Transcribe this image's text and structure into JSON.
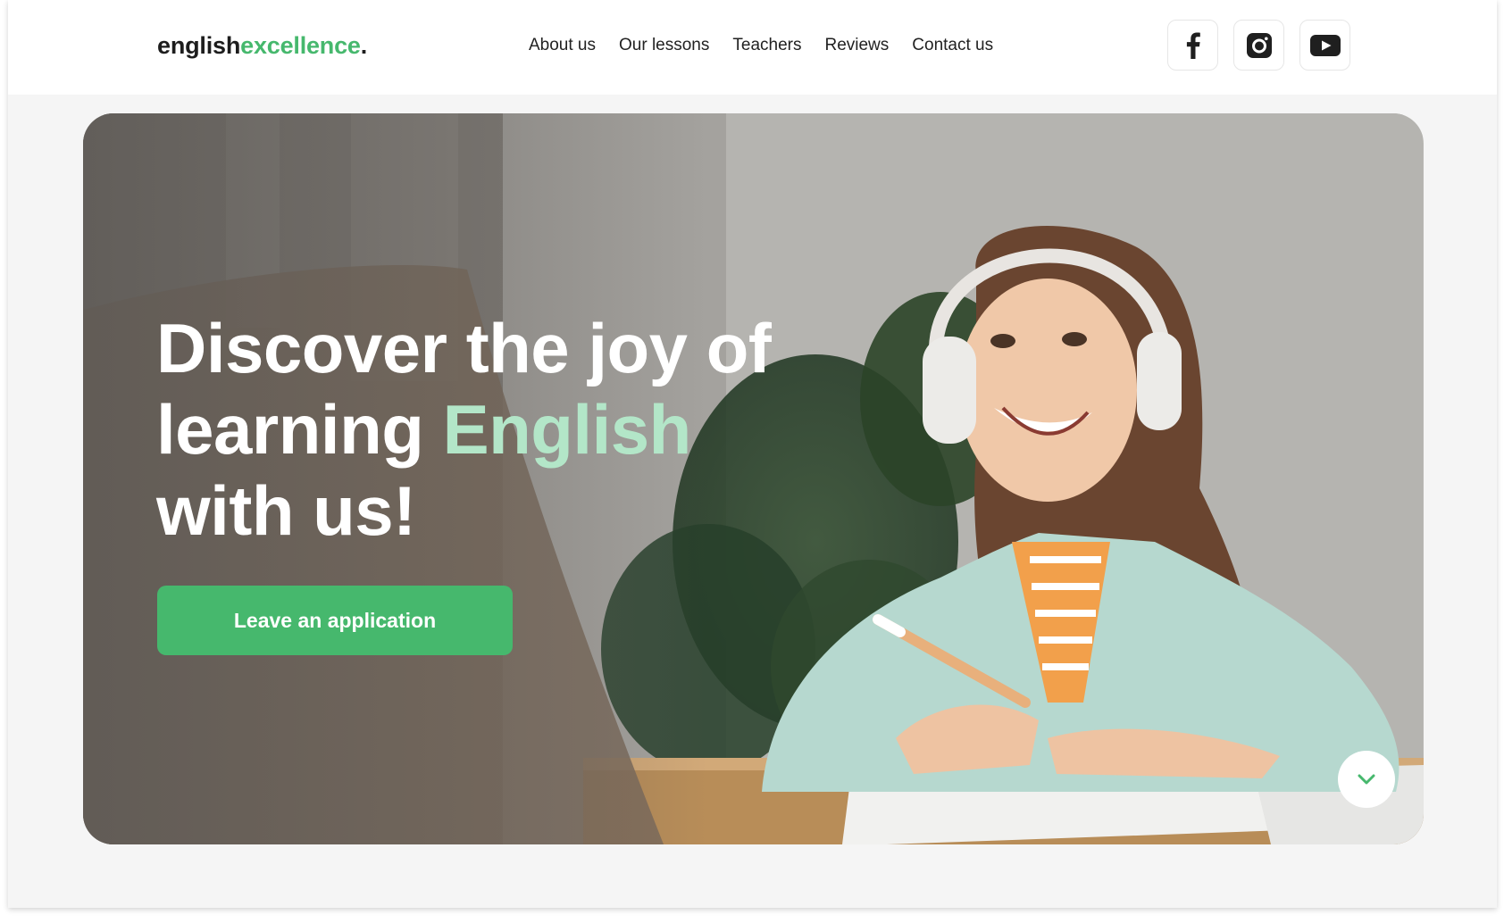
{
  "header": {
    "logo_part1": "english",
    "logo_part2": "excellence",
    "logo_dot": ".",
    "nav": [
      "About us",
      "Our lessons",
      "Teachers",
      "Reviews",
      "Contact us"
    ],
    "socials": [
      "facebook-icon",
      "instagram-icon",
      "youtube-icon"
    ]
  },
  "hero": {
    "title_line1": "Discover the joy of",
    "title_line2_plain": "learning",
    "title_line2_accent": "English",
    "title_line3": "with us!",
    "cta_label": "Leave an application",
    "scroll_icon": "chevron-down-icon"
  },
  "colors": {
    "accent": "#46b86d",
    "accent_light": "#b3e6c8",
    "text_dark": "#1d1d1d"
  }
}
